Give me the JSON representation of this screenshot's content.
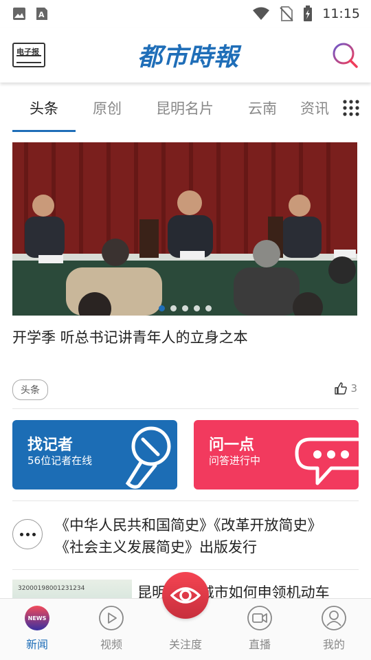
{
  "status_bar": {
    "time": "11:15",
    "icons": [
      "image-icon",
      "a-letter-icon",
      "wifi-icon",
      "no-sim-icon",
      "battery-icon"
    ]
  },
  "header": {
    "epaper_label": "电子报",
    "logo_text": "都市時報",
    "search_icon": "search-icon"
  },
  "tabs": [
    {
      "label": "头条",
      "active": true
    },
    {
      "label": "原创"
    },
    {
      "label": "昆明名片"
    },
    {
      "label": "云南"
    },
    {
      "label": "资讯"
    }
  ],
  "hero": {
    "title": "开学季 听总书记讲青年人的立身之本",
    "tag": "头条",
    "likes": "3",
    "slides": 5,
    "active_slide": 1
  },
  "cards": [
    {
      "title": "找记者",
      "subtitle": "56位记者在线",
      "color": "#1c6db5"
    },
    {
      "title": "问一点",
      "subtitle": "问答进行中",
      "color": "#f23a5e"
    }
  ],
  "news": [
    {
      "title_line1": "《中华人民共和国简史》《改革开放简史》",
      "title_line2": "《社会主义发展简史》出版发行"
    },
    {
      "title": "昆明第  个城市如何申领机动车",
      "thumb_text": "320001980012312​34"
    }
  ],
  "bottom_nav": [
    {
      "label": "新闻",
      "icon": "news-icon",
      "active": true,
      "badge": "NEWS"
    },
    {
      "label": "视频",
      "icon": "play-icon"
    },
    {
      "label": "关注度",
      "icon": "eye-icon"
    },
    {
      "label": "直播",
      "icon": "video-camera-icon"
    },
    {
      "label": "我的",
      "icon": "user-icon"
    }
  ],
  "colors": {
    "brand": "#1f6eb8",
    "accent_red": "#f23a5e"
  }
}
